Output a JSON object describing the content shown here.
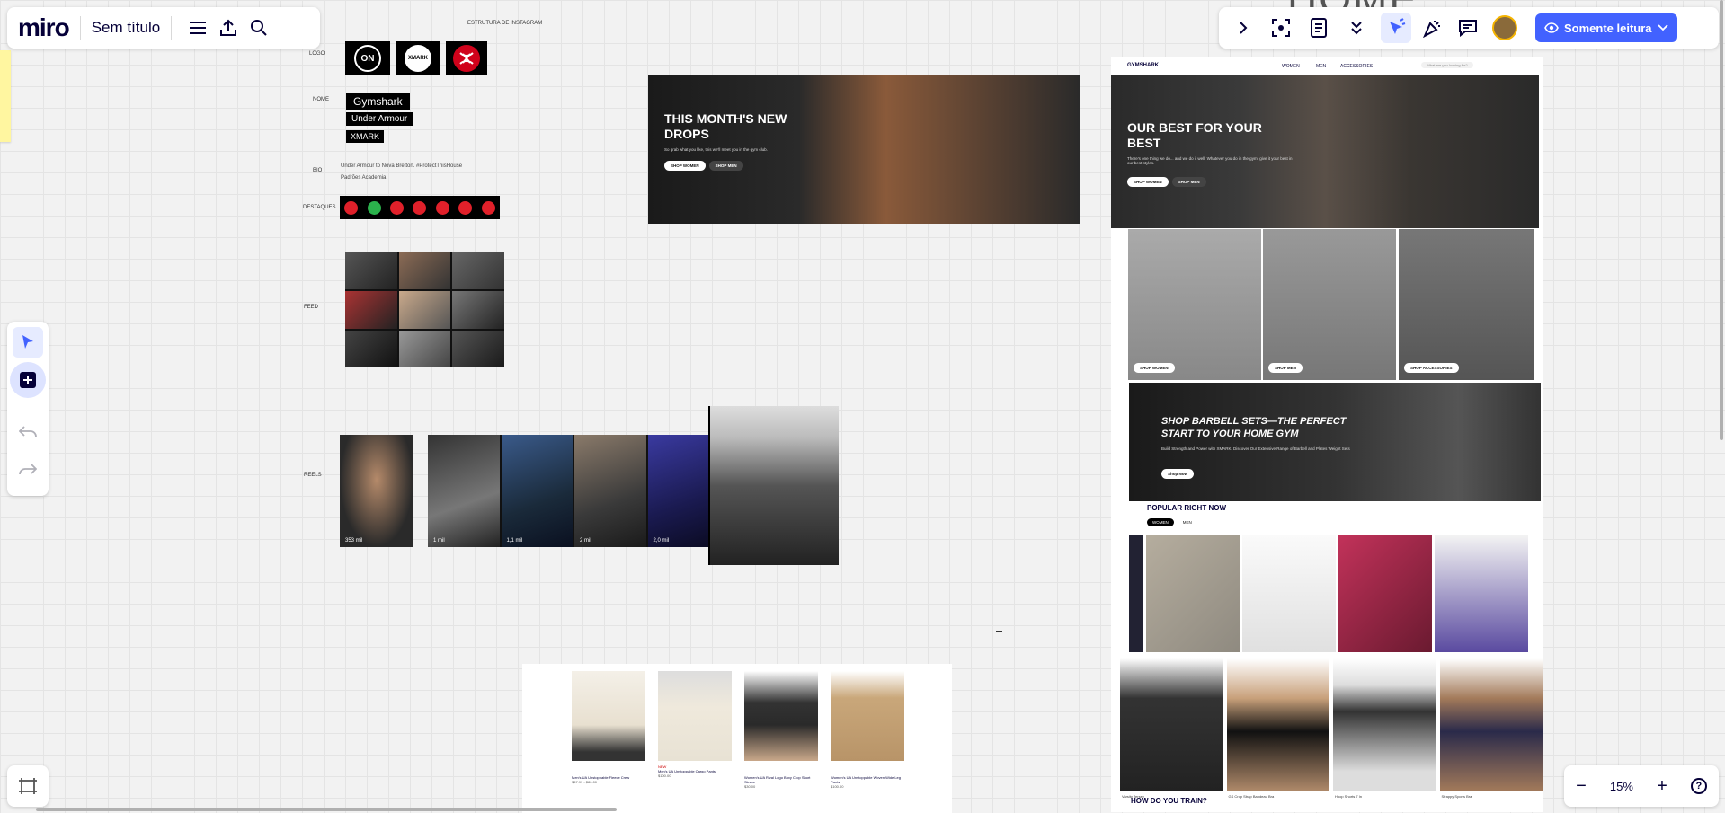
{
  "app": {
    "logo": "miro",
    "board_title": "Sem título"
  },
  "topbar_right": {
    "readonly_label": "Somente leitura"
  },
  "zoom": {
    "level": "15%"
  },
  "canvas": {
    "heading_partial": "HOME",
    "structure_title": "ESTRUTURA DE INSTAGRAM",
    "labels": {
      "logo": "LOGO",
      "nome": "NOME",
      "bio": "BIO",
      "destaques": "DESTAQUES",
      "feed": "FEED",
      "reels": "REELS"
    },
    "logo_texts": {
      "on": "ON",
      "xmark": "XMARK"
    },
    "names": [
      "Gymshark",
      "Under Armour",
      "XMARK"
    ],
    "bio_lines": [
      "Under Armour to Nova Bretton. #ProtectThisHouse",
      "Padrões Academia"
    ],
    "reels_counts": [
      "353 mil",
      "1 mil",
      "1,1 mil",
      "2 mil",
      "2,0 mil"
    ],
    "banner_new_drops": {
      "title": "THIS MONTH'S NEW DROPS",
      "subtitle": "So grab what you like, this we'll meet you in the gym club.",
      "btn_women": "SHOP WOMEN",
      "btn_men": "SHOP MEN"
    },
    "gymshark_site": {
      "brand": "GYMSHARK",
      "nav": [
        "WOMEN",
        "MEN",
        "ACCESSORIES"
      ],
      "search_placeholder": "What are you looking for?",
      "hero_title": "OUR BEST FOR YOUR BEST",
      "hero_sub": "There's one thing we do... and we do it well. Whatever you do in the gym, give it your best in our best styles.",
      "hero_btn_women": "SHOP WOMEN",
      "hero_btn_men": "SHOP MEN",
      "tiles": [
        "SHOP WOMEN",
        "SHOP MEN",
        "SHOP ACCESSORIES"
      ],
      "barbell_title": "SHOP BARBELL SETS—THE PERFECT START TO YOUR HOME GYM",
      "barbell_sub": "Build Strength and Power with XMARK. Discover Our Extensive Range of Barbell and Plates Weight Sets",
      "barbell_btn": "Shop Now",
      "popular_title": "POPULAR RIGHT NOW",
      "popular_tabs": [
        "WOMEN",
        "MEN"
      ],
      "bottom_products": [
        "Varsity Jersey",
        "GS Crop Strap Bandeau Bra",
        "Hoop Shorts 7 In",
        "Strappy Sports Bra"
      ],
      "how_do_you_train": "HOW DO YOU TRAIN?"
    },
    "product_strip": {
      "items": [
        {
          "name": "Men's UA Unstoppable Fleece Crew",
          "price": "$67.99 - $80.00"
        },
        {
          "name": "Men's UA Unstoppable Cargo Pants",
          "price": "$100.00"
        },
        {
          "name": "Women's UA Rival Logo Boxy Crop Short Sleeve",
          "price": "$30.00"
        },
        {
          "name": "Women's UA Unstoppable Woven Wide Leg Pants",
          "price": "$100.00"
        }
      ],
      "new_tag": "NEW"
    }
  }
}
